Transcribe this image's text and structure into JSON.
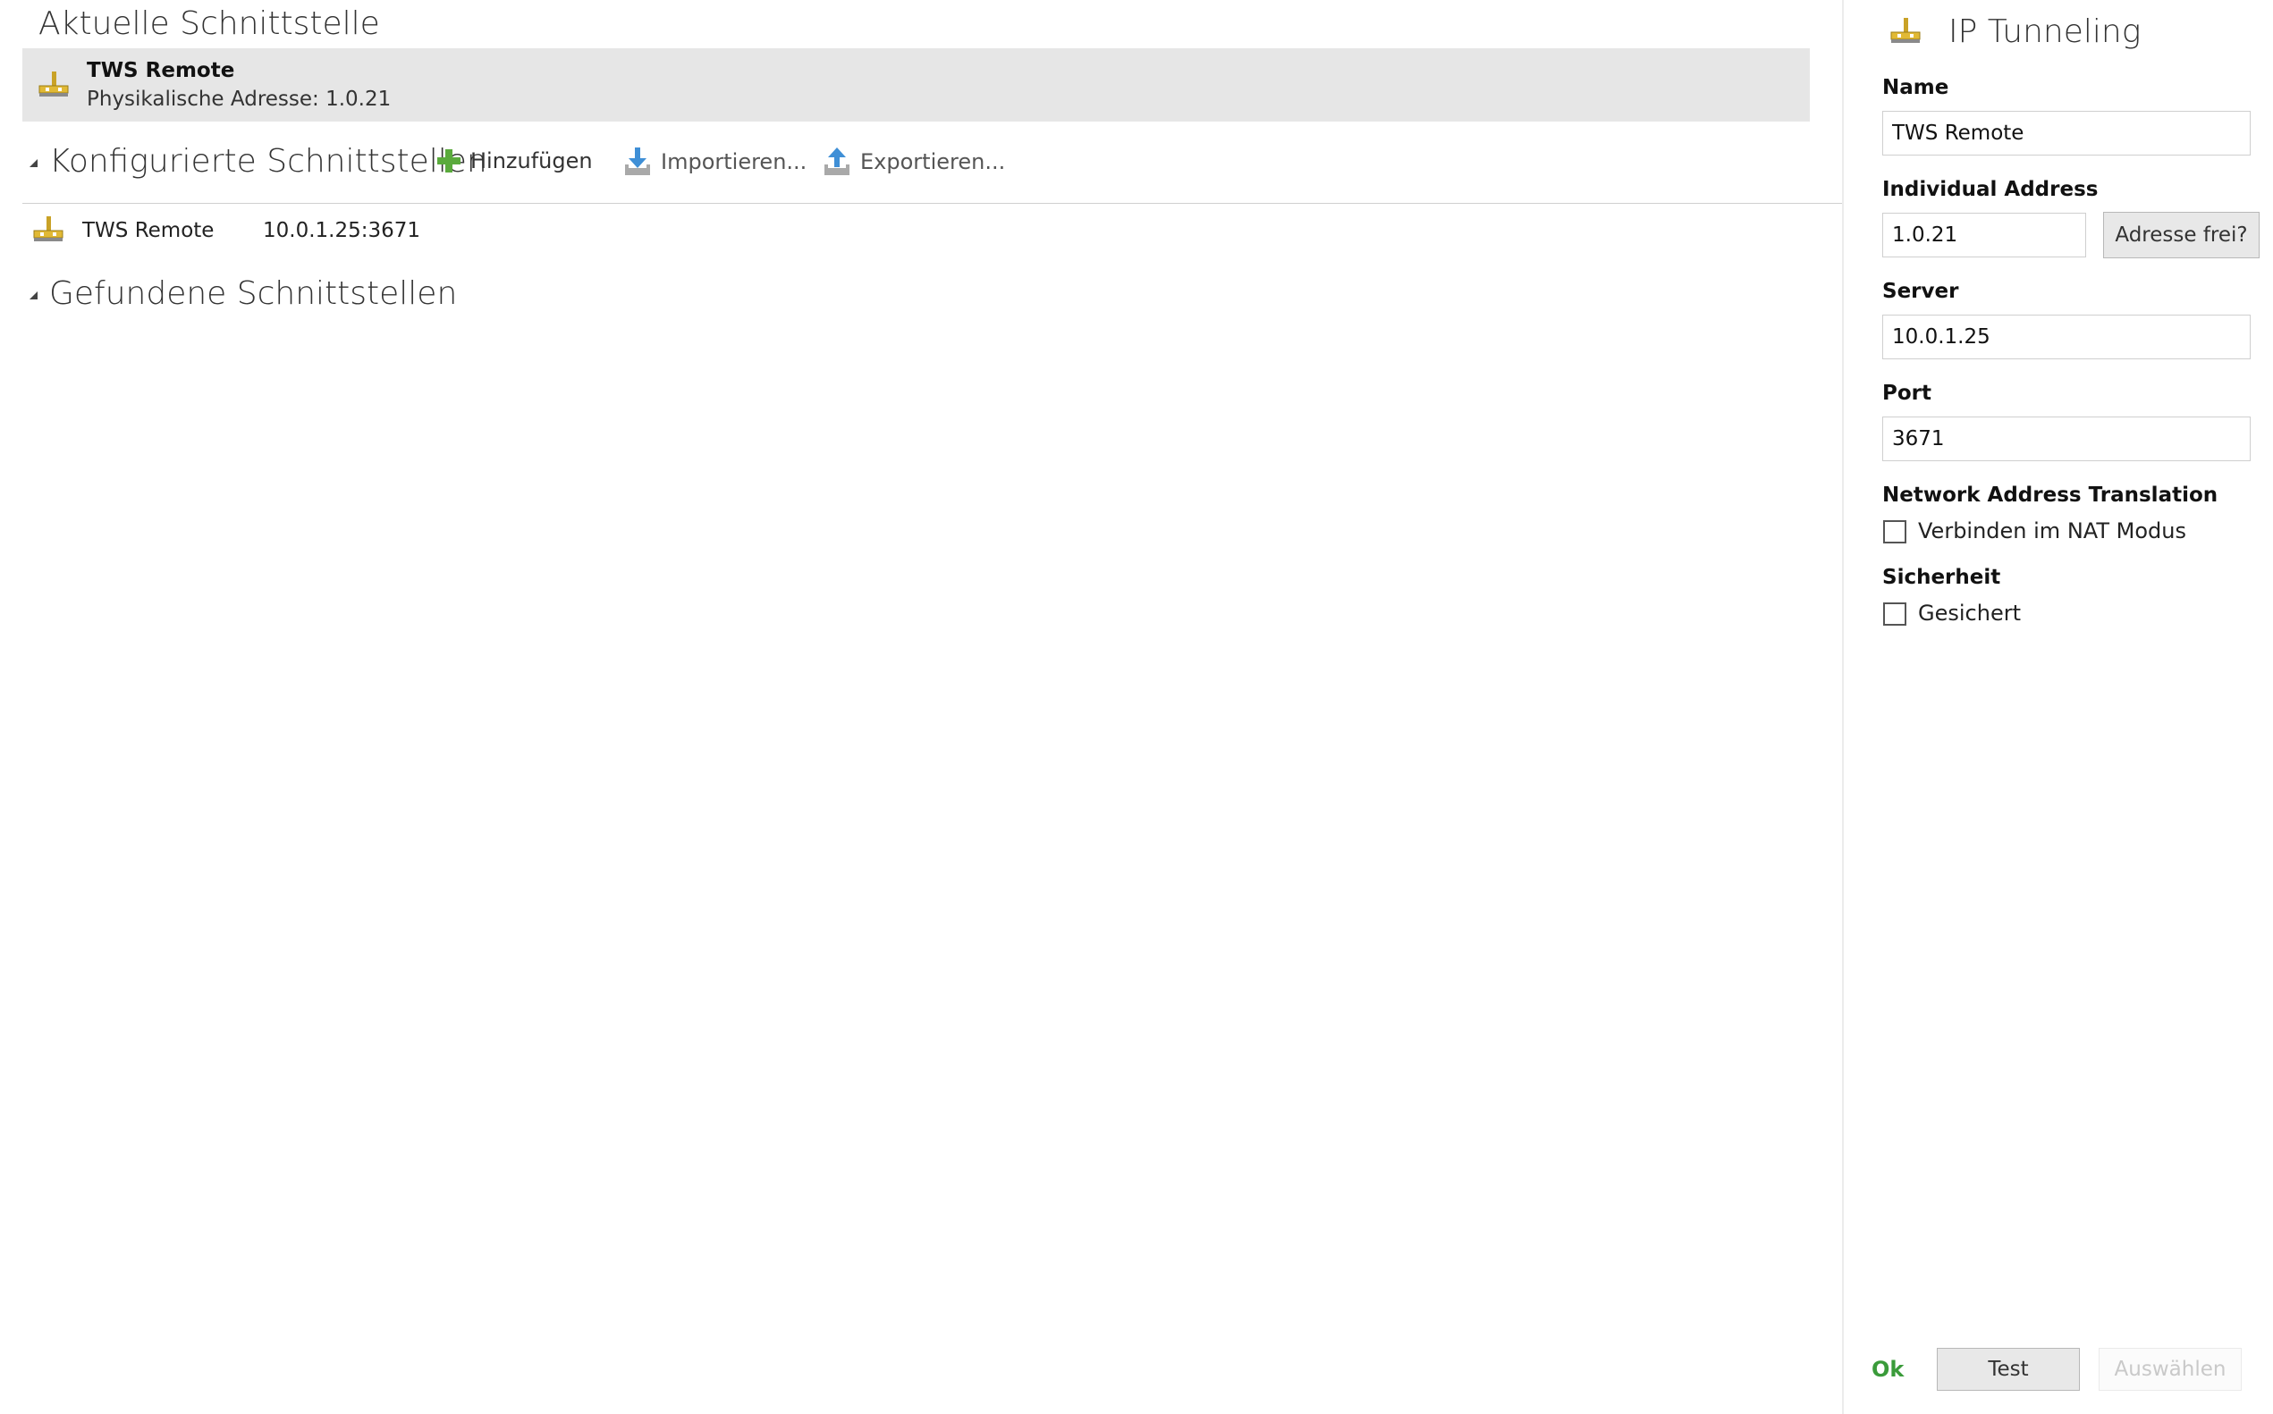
{
  "current": {
    "heading": "Aktuelle Schnittstelle",
    "name": "TWS Remote",
    "address_line": "Physikalische Adresse: 1.0.21"
  },
  "configured": {
    "heading": "Konfigurierte Schnittstellen",
    "toolbar": {
      "add_label": "Hinzufügen",
      "import_label": "Importieren...",
      "export_label": "Exportieren..."
    },
    "rows": [
      {
        "name": "TWS Remote",
        "endpoint": "10.0.1.25:3671"
      }
    ]
  },
  "found": {
    "heading": "Gefundene Schnittstellen"
  },
  "panel": {
    "title": "IP Tunneling",
    "name_label": "Name",
    "name_value": "TWS Remote",
    "address_label": "Individual Address",
    "address_value": "1.0.21",
    "address_check_button": "Adresse frei?",
    "server_label": "Server",
    "server_value": "10.0.1.25",
    "port_label": "Port",
    "port_value": "3671",
    "nat_label": "Network Address Translation",
    "nat_checkbox_label": "Verbinden im NAT Modus",
    "nat_checked": false,
    "security_label": "Sicherheit",
    "security_checkbox_label": "Gesichert",
    "security_checked": false,
    "ok_label": "Ok",
    "test_label": "Test",
    "select_label": "Auswählen"
  },
  "colors": {
    "add_icon": "#5aaa3c",
    "transfer_icon": "#3f8fd6",
    "ok_text": "#3a9b3a",
    "selected_card_bg": "#e6e6e6"
  },
  "icons": {
    "interface": "network-interface-icon",
    "add": "plus-icon",
    "import": "download-tray-icon",
    "export": "upload-tray-icon",
    "collapse": "triangle-collapse-icon"
  }
}
